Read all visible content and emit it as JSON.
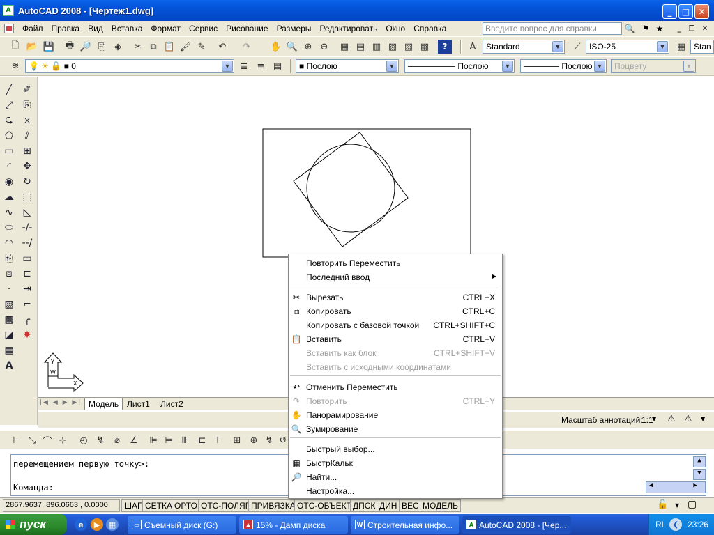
{
  "window": {
    "title": "AutoCAD 2008 - [Чертеж1.dwg]",
    "app_icon": "A"
  },
  "menubar": {
    "items": [
      "Файл",
      "Правка",
      "Вид",
      "Вставка",
      "Формат",
      "Сервис",
      "Рисование",
      "Размеры",
      "Редактировать",
      "Окно",
      "Справка"
    ],
    "help_placeholder": "Введите вопрос для справки"
  },
  "toolbar_standard": {
    "text_style": "Standard",
    "dim_style": "ISO-25",
    "table_style": "Stan"
  },
  "toolbar_layers": {
    "layer": "0",
    "color": "Послою",
    "linetype": "Послою",
    "lineweight": "Послою",
    "plotstyle": "Поцвету"
  },
  "layout_tabs": [
    "Модель",
    "Лист1",
    "Лист2"
  ],
  "annotation": {
    "label": "Масштаб аннотаций:",
    "value": "1:1"
  },
  "command_line": {
    "line1": "перемещением первую точку>:",
    "line2": "",
    "prompt": "Команда:"
  },
  "statusbar": {
    "coords": "2867.9637, 896.0663 , 0.0000",
    "buttons": [
      "ШАГ",
      "СЕТКА",
      "ОРТО",
      "ОТС-ПОЛЯР",
      "ПРИВЯЗКА",
      "ОТС-ОБЪЕКТ",
      "ДПСК",
      "ДИН",
      "ВЕС",
      "МОДЕЛЬ"
    ]
  },
  "context_menu": {
    "items": [
      {
        "label": "Повторить Переместить",
        "shortcut": "",
        "disabled": false,
        "icon": ""
      },
      {
        "label": "Последний ввод",
        "shortcut": "",
        "disabled": false,
        "icon": "",
        "submenu": true
      },
      {
        "label": "Вырезать",
        "shortcut": "CTRL+X",
        "disabled": false,
        "icon": "scissors-icon"
      },
      {
        "label": "Копировать",
        "shortcut": "CTRL+C",
        "disabled": false,
        "icon": "copy-icon"
      },
      {
        "label": "Копировать с базовой точкой",
        "shortcut": "CTRL+SHIFT+C",
        "disabled": false,
        "icon": ""
      },
      {
        "label": "Вставить",
        "shortcut": "CTRL+V",
        "disabled": false,
        "icon": "paste-icon"
      },
      {
        "label": "Вставить как блок",
        "shortcut": "CTRL+SHIFT+V",
        "disabled": true,
        "icon": ""
      },
      {
        "label": "Вставить с исходными координатами",
        "shortcut": "",
        "disabled": true,
        "icon": ""
      },
      {
        "label": "Отменить Переместить",
        "shortcut": "",
        "disabled": false,
        "icon": "undo-icon"
      },
      {
        "label": "Повторить",
        "shortcut": "CTRL+Y",
        "disabled": true,
        "icon": "redo-icon"
      },
      {
        "label": "Панорамирование",
        "shortcut": "",
        "disabled": false,
        "icon": "pan-icon"
      },
      {
        "label": "Зумирование",
        "shortcut": "",
        "disabled": false,
        "icon": "zoom-icon"
      },
      {
        "label": "Быстрый выбор...",
        "shortcut": "",
        "disabled": false,
        "icon": ""
      },
      {
        "label": "БыстрКальк",
        "shortcut": "",
        "disabled": false,
        "icon": "calculator-icon"
      },
      {
        "label": "Найти...",
        "shortcut": "",
        "disabled": false,
        "icon": "find-icon"
      },
      {
        "label": "Настройка...",
        "shortcut": "",
        "disabled": false,
        "icon": ""
      }
    ]
  },
  "taskbar": {
    "start": "пуск",
    "tasks": [
      {
        "label": "Съемный диск (G:)"
      },
      {
        "label": "15% - Дамп диска"
      },
      {
        "label": "Строительная инфо..."
      },
      {
        "label": "AutoCAD 2008 - [Чер..."
      }
    ],
    "lang": "RL",
    "clock": "23:26"
  },
  "ucs": {
    "x": "X",
    "y": "Y",
    "w": "W"
  },
  "colors": {
    "titlebar": "#0453d8",
    "taskbar": "#245edb",
    "face": "#ece9d8",
    "start": "#2c8a2c"
  }
}
